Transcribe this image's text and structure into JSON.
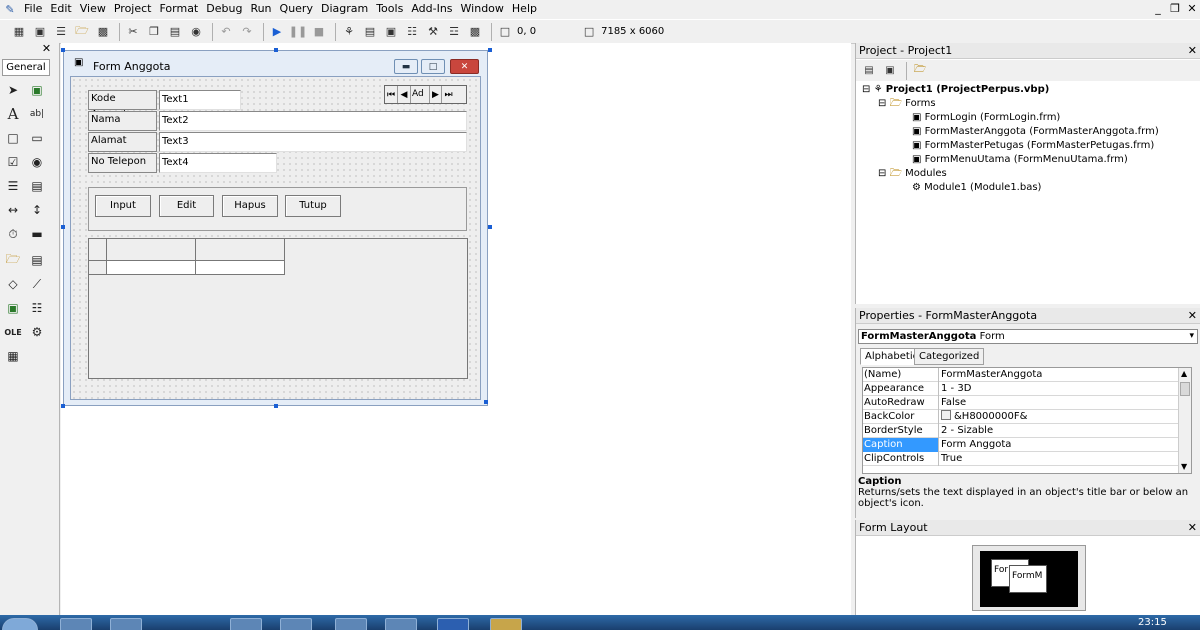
{
  "menu": [
    "File",
    "Edit",
    "View",
    "Project",
    "Format",
    "Debug",
    "Run",
    "Query",
    "Diagram",
    "Tools",
    "Add-Ins",
    "Window",
    "Help"
  ],
  "toolbar": {
    "position": "0, 0",
    "size": "7185 x 6060"
  },
  "toolbox": {
    "tab": "General",
    "close": "✕"
  },
  "form": {
    "caption": "Form Anggota",
    "labels": [
      "Kode Anggota",
      "Nama",
      "Alamat",
      "No Telepon"
    ],
    "texts": [
      "Text1",
      "Text2",
      "Text3",
      "Text4"
    ],
    "adodc_caption": "Ad",
    "buttons": [
      "Input",
      "Edit",
      "Hapus",
      "Tutup"
    ]
  },
  "project": {
    "title": "Project - Project1",
    "root": "Project1 (ProjectPerpus.vbp)",
    "forms_folder": "Forms",
    "forms": [
      "FormLogin (FormLogin.frm)",
      "FormMasterAnggota (FormMasterAnggota.frm)",
      "FormMasterPetugas (FormMasterPetugas.frm)",
      "FormMenuUtama (FormMenuUtama.frm)"
    ],
    "modules_folder": "Modules",
    "modules": [
      "Module1 (Module1.bas)"
    ]
  },
  "properties": {
    "title": "Properties - FormMasterAnggota",
    "object_name": "FormMasterAnggota",
    "object_type": "Form",
    "tabs": [
      "Alphabetic",
      "Categorized"
    ],
    "rows": [
      {
        "k": "(Name)",
        "v": "FormMasterAnggota"
      },
      {
        "k": "Appearance",
        "v": "1 - 3D"
      },
      {
        "k": "AutoRedraw",
        "v": "False"
      },
      {
        "k": "BackColor",
        "v": "&H8000000F&"
      },
      {
        "k": "BorderStyle",
        "v": "2 - Sizable"
      },
      {
        "k": "Caption",
        "v": "Form Anggota"
      },
      {
        "k": "ClipControls",
        "v": "True"
      }
    ],
    "selected_row": 5,
    "desc_title": "Caption",
    "desc_text": "Returns/sets the text displayed in an object's title bar or below an object's icon."
  },
  "form_layout": {
    "title": "Form Layout",
    "thumb1": "For",
    "thumb2": "FormM"
  },
  "clock": "23:15",
  "colors": {
    "selection": "#3399ff",
    "taskbar": "#1f4f86",
    "grip": "#1a5fd4"
  }
}
